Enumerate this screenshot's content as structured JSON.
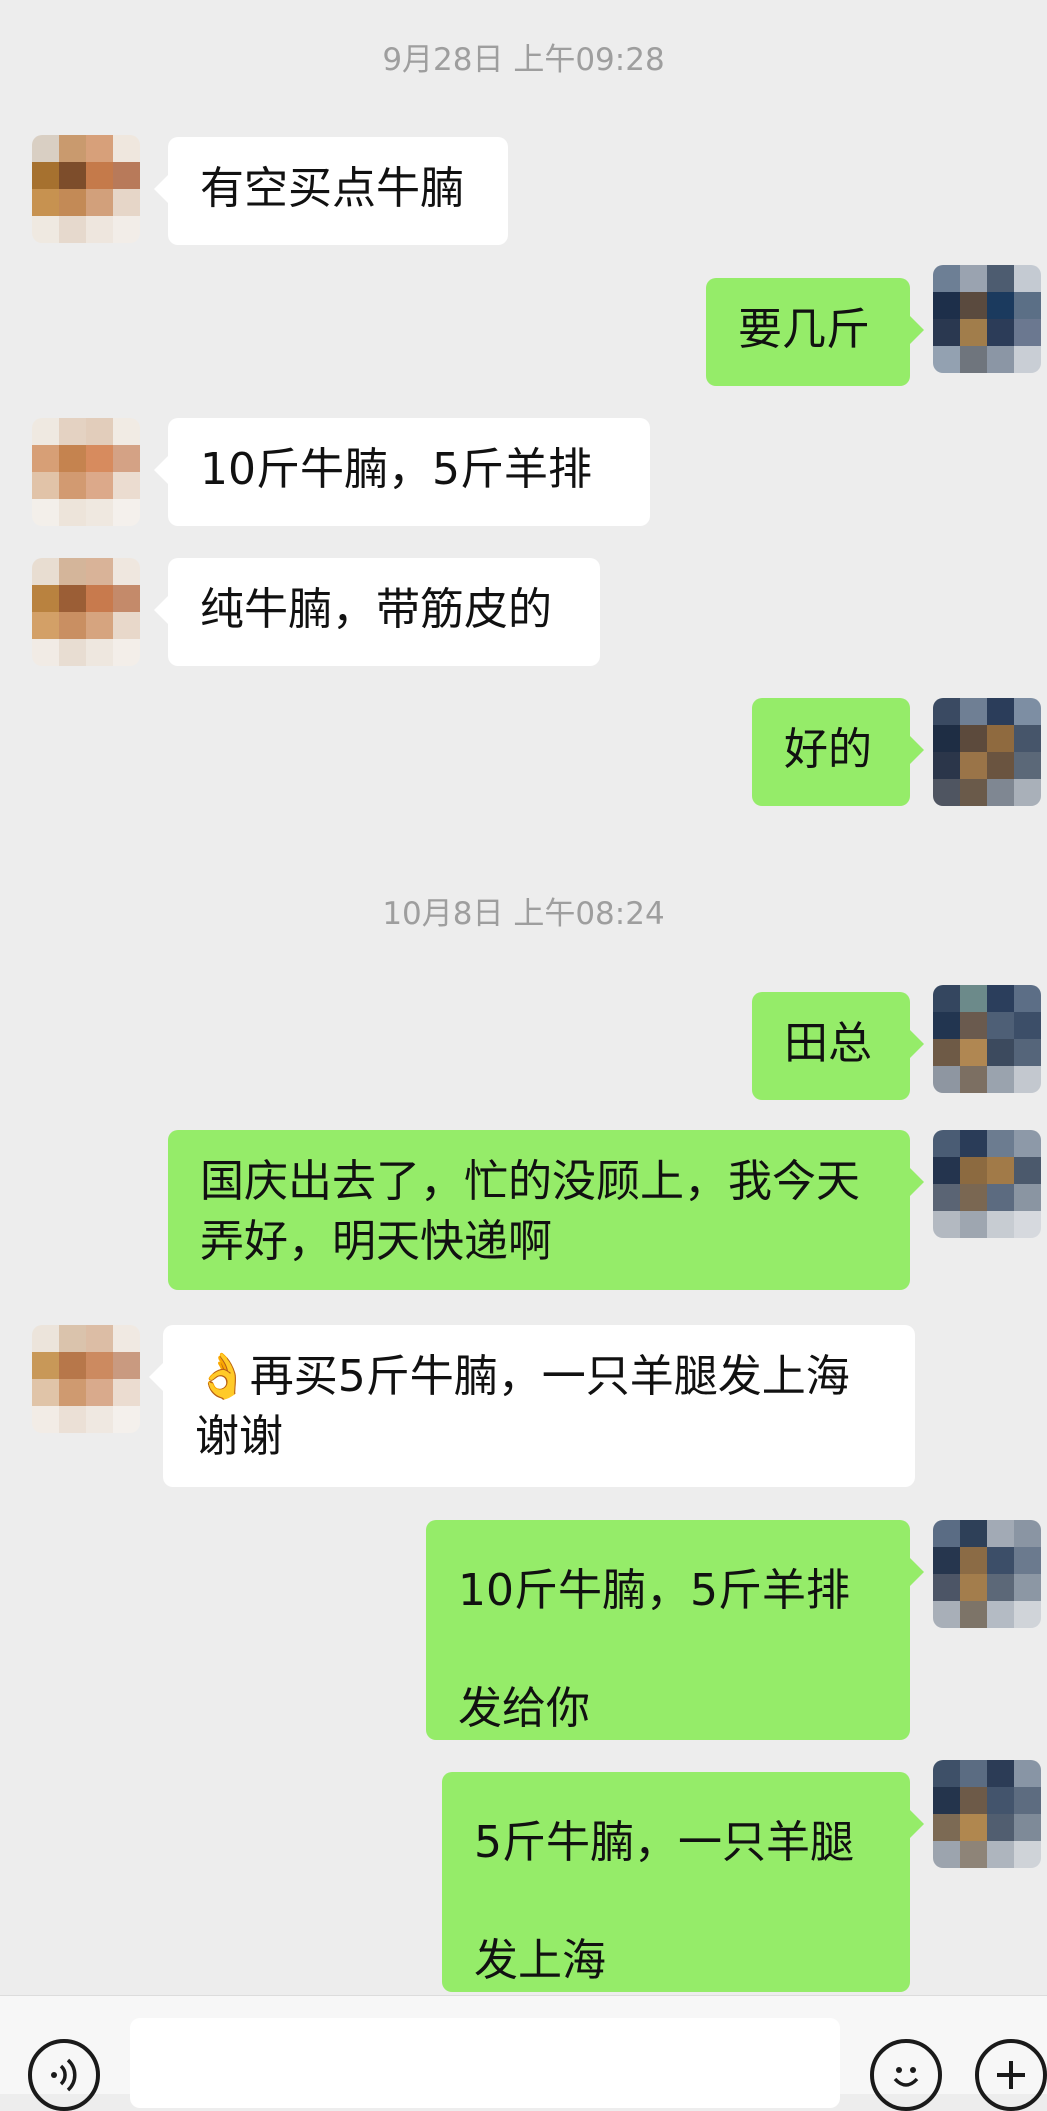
{
  "chat": {
    "timestamps": [
      "9月28日 上午09:28",
      "10月8日 上午08:24"
    ],
    "messages": [
      {
        "side": "in",
        "text": "有空买点牛腩"
      },
      {
        "side": "out",
        "text": "要几斤"
      },
      {
        "side": "in",
        "text": "10斤牛腩，5斤羊排"
      },
      {
        "side": "in",
        "text": "纯牛腩，带筋皮的"
      },
      {
        "side": "out",
        "text": "好的"
      },
      {
        "side": "out",
        "text": "田总"
      },
      {
        "side": "out",
        "text": "国庆出去了，忙的没顾上，我今天\n弄好，明天快递啊"
      },
      {
        "side": "in",
        "text": "👌再买5斤牛腩，一只羊腿发上海\n谢谢"
      },
      {
        "side": "out",
        "text": "10斤牛腩，5斤羊排\n发给你"
      },
      {
        "side": "out",
        "text": "5斤牛腩，一只羊腿\n发上海"
      }
    ]
  },
  "input_bar": {
    "voice_icon": "voice-icon",
    "emoji_icon": "emoji-icon",
    "plus_icon": "plus-icon",
    "input_value": ""
  },
  "colors": {
    "background": "#ededed",
    "incoming_bubble": "#ffffff",
    "outgoing_bubble": "#95ec69",
    "timestamp_text": "#9e9e9e"
  }
}
